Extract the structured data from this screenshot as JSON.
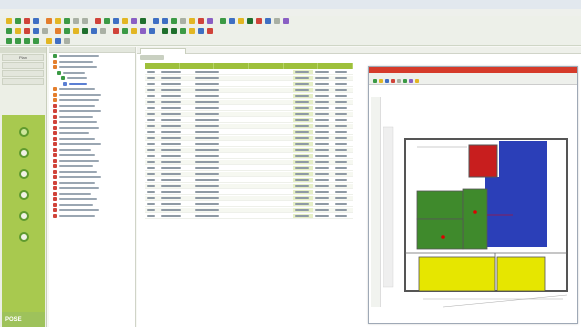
{
  "window": {
    "title": ""
  },
  "menu": [
    "",
    "",
    "",
    "",
    "",
    "",
    "",
    "",
    "",
    ""
  ],
  "nav": {
    "tabs": [
      "Plan",
      "",
      "",
      ""
    ],
    "buttons": [
      "",
      "",
      "",
      "",
      "",
      ""
    ],
    "brand": "POSE"
  },
  "table": {
    "rows": 25
  },
  "floorplan": {
    "window_title": "",
    "zone_colors": {
      "red": "#c81e1e",
      "blue": "#2b3fb8",
      "green": "#3f8a2c",
      "yellow": "#e6e600"
    }
  },
  "colors": {
    "accent_green": "#a8c94f",
    "header_green": "#9ec03b"
  }
}
